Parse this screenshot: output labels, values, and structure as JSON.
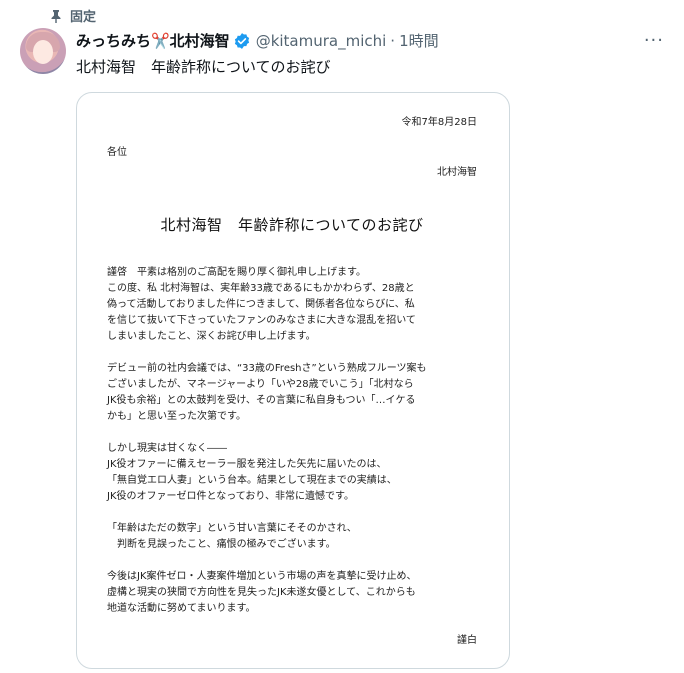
{
  "pinned": {
    "label": "固定"
  },
  "author": {
    "display_name": "みっちみち✂️北村海智",
    "handle": "@kitamura_michi",
    "separator": "·",
    "time": "1時間"
  },
  "more_button": "···",
  "tweet_text": "北村海智　年齢詐称についてのお詫び",
  "document": {
    "date": "令和7年8月28日",
    "recipient": "各位",
    "sender": "北村海智",
    "title": "北村海智　年齢詐称についてのお詫び",
    "paragraphs": [
      "謹啓　平素は格別のご高配を賜り厚く御礼申し上げます。\nこの度、私 北村海智は、実年齢33歳であるにもかかわらず、28歳と\n偽って活動しておりました件につきまして、関係者各位ならびに、私\nを信じて抜いて下さっていたファンのみなさまに大きな混乱を招いて\nしまいましたこと、深くお詫び申し上げます。",
      "デビュー前の社内会議では、“33歳のFreshさ”という熟成フルーツ案も\nございましたが、マネージャーより「いや28歳でいこう」「北村なら\nJK役も余裕」との太鼓判を受け、その言葉に私自身もつい「…イケる\nかも」と思い至った次第です。",
      "しかし現実は甘くなく――\nJK役オファーに備えセーラー服を発注した矢先に届いたのは、\n「無自覚エロ人妻」という台本。結果として現在までの実績は、\nJK役のオファーゼロ件となっており、非常に遺憾です。",
      "「年齢はただの数字」という甘い言葉にそそのかされ、\n　判断を見誤ったこと、痛恨の極みでございます。",
      "今後はJK案件ゼロ・人妻案件増加という市場の声を真摯に受け止め、\n虚構と現実の狭間で方向性を見失ったJK未遂女優として、これからも\n地道な活動に努めてまいります。"
    ],
    "closing": "謹白"
  },
  "colors": {
    "text_primary": "#0f1419",
    "text_secondary": "#536471",
    "verified_blue": "#1d9bf0",
    "border": "#cfd9de"
  },
  "icons": {
    "pin": "pin-icon",
    "verified": "verified-badge-icon",
    "more": "more-options-icon"
  }
}
